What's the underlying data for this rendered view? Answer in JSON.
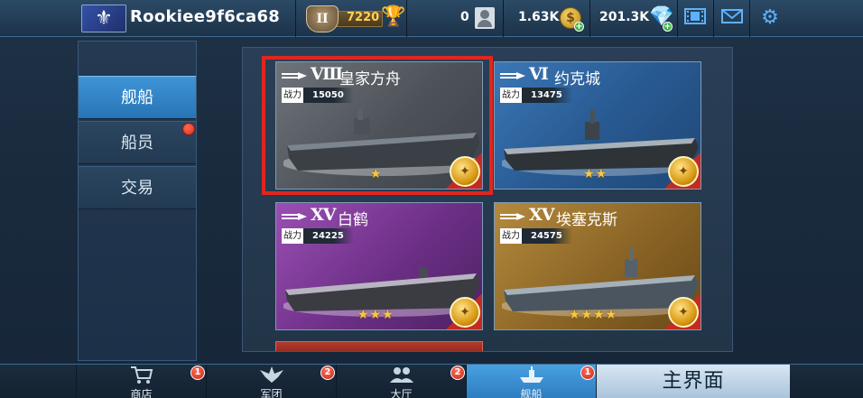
{
  "player": {
    "name": "Rookiee9f6ca68",
    "avatar_icon": "fleur-de-lis-icon"
  },
  "topbar": {
    "rank_roman": "II",
    "rank_points": "7220",
    "friends_count": "0",
    "coins": "1.63K",
    "gems": "201.3K"
  },
  "side_tabs": [
    {
      "label": "舰船",
      "active": true
    },
    {
      "label": "船员",
      "active": false,
      "has_alert": true
    },
    {
      "label": "交易",
      "active": false
    }
  ],
  "ships": [
    {
      "tier": "Ⅷ",
      "name": "皇家方舟",
      "power_label": "战力",
      "power": "15050",
      "stars": "★",
      "theme": "grey",
      "selected": true
    },
    {
      "tier": "Ⅵ",
      "name": "约克城",
      "power_label": "战力",
      "power": "13475",
      "stars": "★★",
      "theme": "blue",
      "selected": false
    },
    {
      "tier": "XV",
      "name": "白鹤",
      "power_label": "战力",
      "power": "24225",
      "stars": "★★★",
      "theme": "purple",
      "selected": false
    },
    {
      "tier": "XV",
      "name": "埃塞克斯",
      "power_label": "战力",
      "power": "24575",
      "stars": "★★★★",
      "theme": "gold",
      "selected": false
    }
  ],
  "bottom_nav": [
    {
      "label": "商店",
      "badge": "1",
      "icon": "cart-icon"
    },
    {
      "label": "军团",
      "badge": "2",
      "icon": "eagle-icon"
    },
    {
      "label": "大厅",
      "badge": "2",
      "icon": "people-icon"
    },
    {
      "label": "舰船",
      "badge": "1",
      "icon": "ship-icon",
      "active": true
    }
  ],
  "home_button": "主界面",
  "colors": {
    "accent_blue": "#2d7cc0",
    "selection_red": "#e0261f",
    "star_gold": "#f5c74a"
  }
}
